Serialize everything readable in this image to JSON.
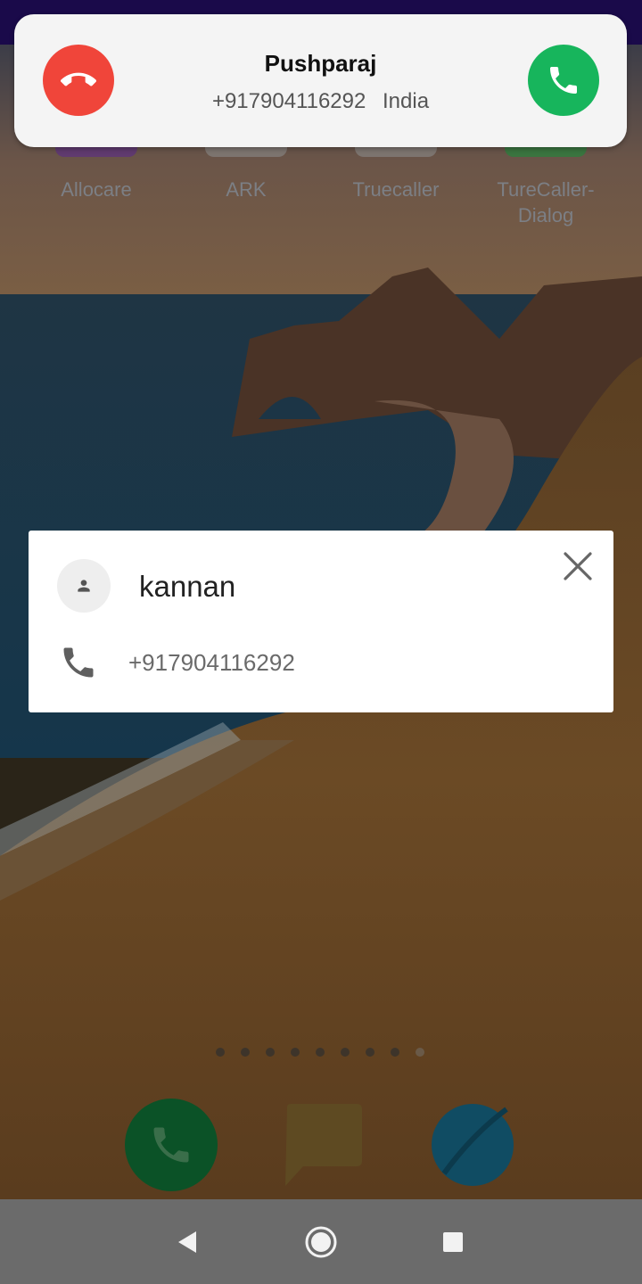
{
  "home": {
    "apps": [
      {
        "label": "Allocare",
        "color": "#5a2a8a"
      },
      {
        "label": "ARK",
        "color": "#8a8a8a"
      },
      {
        "label": "Truecaller",
        "color": "#8a8a8a"
      },
      {
        "label": "TureCaller-\nDialog",
        "color": "#1a8a3a"
      }
    ],
    "page_dots_count": 9,
    "active_page_index": 8,
    "dock": [
      {
        "name": "phone-icon",
        "color": "#0b5227"
      },
      {
        "name": "messages-icon",
        "color": "#5e4a22"
      },
      {
        "name": "browser-icon",
        "color": "#104c63"
      }
    ]
  },
  "incoming_call": {
    "caller_name": "Pushparaj",
    "number": "+917904116292",
    "country": "India",
    "decline_color": "#f0453a",
    "accept_color": "#17b55c"
  },
  "contact_card": {
    "name": "kannan",
    "number": "+917904116292"
  },
  "nav": {
    "back_icon": "back-triangle-icon",
    "home_icon": "home-circle-icon",
    "recents_icon": "recents-square-icon"
  }
}
